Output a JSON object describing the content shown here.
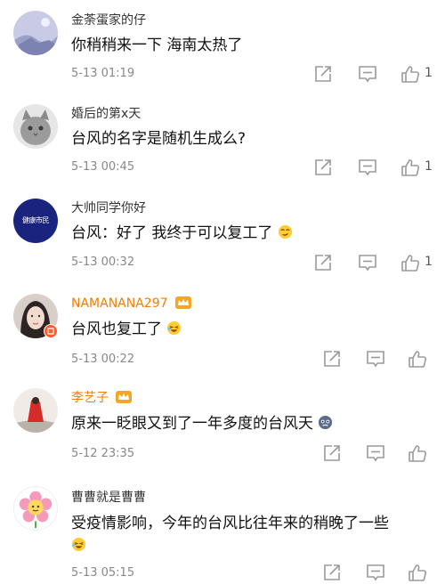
{
  "comments": [
    {
      "username": "金荼蛋家的仔",
      "text": "你稍稍来一下  海南太热了",
      "time": "5-13 01:19",
      "likes": "1",
      "vip": false,
      "avatar_icon": "blue-sky-landscape-avatar"
    },
    {
      "username": "婚后的第x天",
      "text": "台风的名字是随机生成么?",
      "time": "5-13 00:45",
      "likes": "1",
      "vip": false,
      "avatar_icon": "cat-avatar"
    },
    {
      "username": "大帅同学你好",
      "text": "台风：好了 我终于可以复工了",
      "time": "5-13 00:32",
      "likes": "1",
      "vip": false,
      "avatar_icon": "navy-badge-avatar",
      "avatar_text": "健康市民"
    },
    {
      "username": "NAMANANA297",
      "text": "台风也复工了",
      "time": "5-13 00:22",
      "likes": "",
      "vip": true,
      "avatar_icon": "girl-portrait-avatar"
    },
    {
      "username": "李艺子",
      "text": "原来一眨眼又到了一年多度的台风天",
      "time": "5-12 23:35",
      "likes": "",
      "vip": true,
      "avatar_icon": "red-scarf-avatar"
    },
    {
      "username": "曹曹就是曹曹",
      "text": "受疫情影响，今年的台风比往年来的稍晚了一些",
      "time": "5-13 05:15",
      "likes": "",
      "vip": false,
      "avatar_icon": "flower-avatar"
    }
  ],
  "colors": {
    "vip_name": "#f57c00",
    "meta": "#888888",
    "icon": "#9a9a9a"
  }
}
